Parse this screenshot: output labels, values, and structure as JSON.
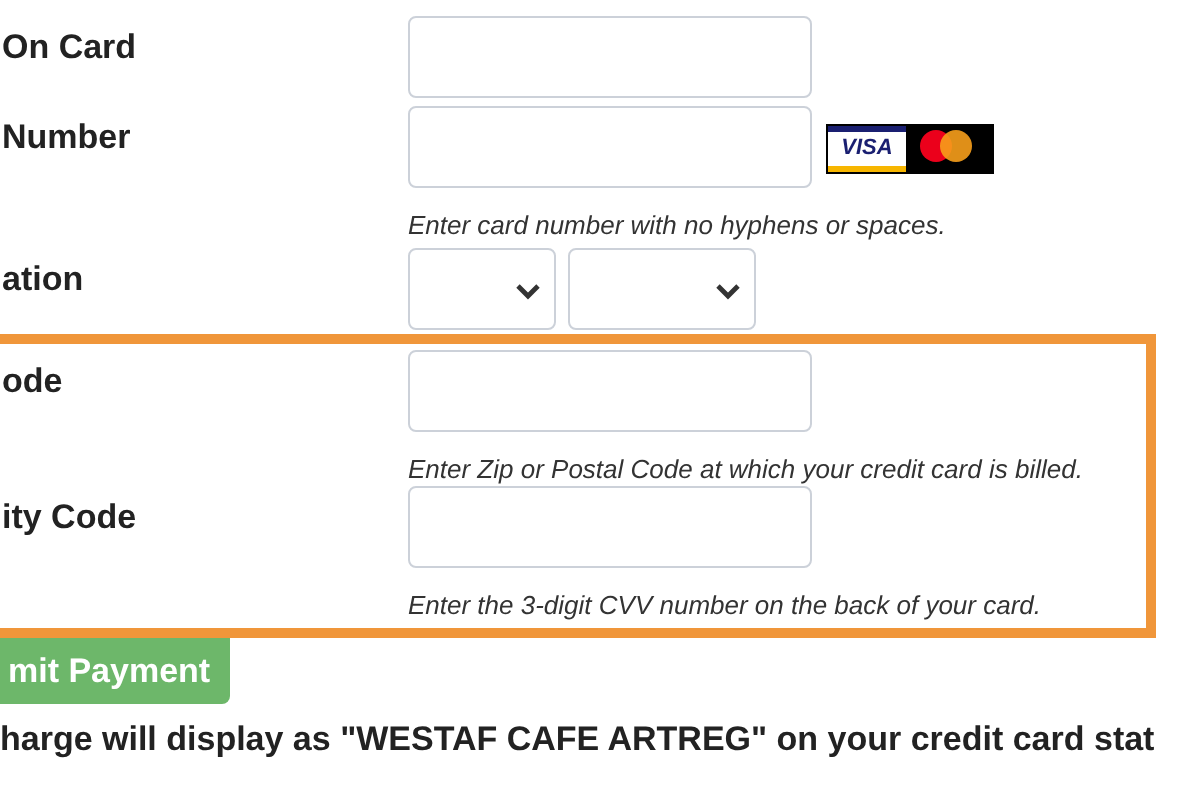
{
  "fields": [
    {
      "kind": "text",
      "label": "On Card",
      "highlighted": false
    },
    {
      "kind": "card",
      "label": "Number",
      "hint": "Enter card number with no hyphens or spaces.",
      "highlighted": false,
      "logos": [
        "VISA"
      ]
    },
    {
      "kind": "selects",
      "label": "ation",
      "highlighted": false
    },
    {
      "kind": "text",
      "label": "ode",
      "hint": "Enter Zip or Postal Code at which your credit card is billed.",
      "highlighted": true
    },
    {
      "kind": "text",
      "label": "ity Code",
      "hint": "Enter the 3-digit CVV number on the back of your card.",
      "highlighted": true
    }
  ],
  "submit_button": "mit Payment",
  "notice": "harge will display as \"WESTAF CAFE ARTREG\" on your credit card stat"
}
